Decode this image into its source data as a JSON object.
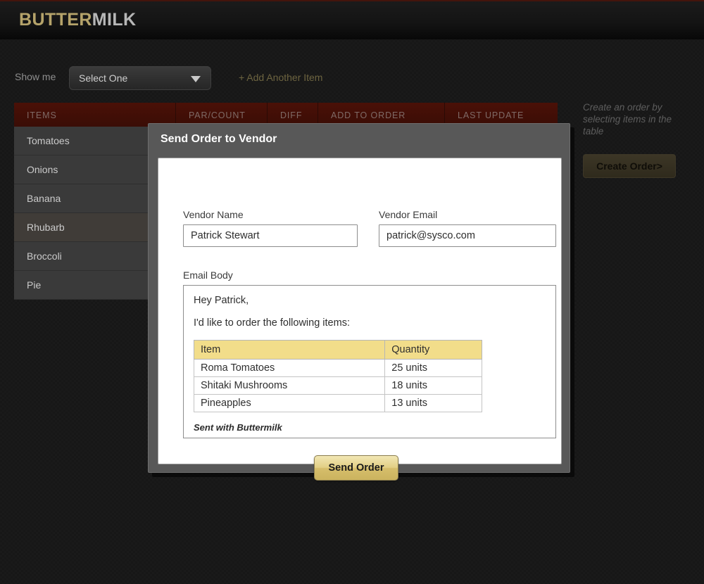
{
  "app": {
    "logo_primary": "BUTTER",
    "logo_secondary": "MILK"
  },
  "colors": {
    "accent_gold": "#b5a36a",
    "header_bar": "#141414",
    "table_header_red": "#4a1007",
    "email_table_header_yellow": "#f2dd8a",
    "send_button_gold": "#e2cf85",
    "page_background": "#171717"
  },
  "filter_bar": {
    "show_me_label": "Show me",
    "select_value": "Select One",
    "add_item_link": "+ Add Another Item"
  },
  "table": {
    "columns": [
      "ITEMS",
      "PAR/COUNT",
      "DIFF",
      "ADD TO ORDER",
      "LAST UPDATE"
    ],
    "rows": [
      {
        "item": "Tomatoes",
        "par_count": "",
        "diff": "",
        "add_to_order": "",
        "last_update": ""
      },
      {
        "item": "Onions",
        "par_count": "",
        "diff": "",
        "add_to_order": "",
        "last_update": ""
      },
      {
        "item": "Banana",
        "par_count": "",
        "diff": "",
        "add_to_order": "",
        "last_update": ""
      },
      {
        "item": "Rhubarb",
        "par_count": "",
        "diff": "",
        "add_to_order": "",
        "last_update": ""
      },
      {
        "item": "Broccoli",
        "par_count": "",
        "diff": "",
        "add_to_order": "",
        "last_update": ""
      },
      {
        "item": "Pie",
        "par_count": "",
        "diff": "",
        "add_to_order": "",
        "last_update": ""
      }
    ]
  },
  "sidebar": {
    "hint": "Create an order by selecting items in the table",
    "create_order_label": "Create Order>"
  },
  "modal": {
    "title": "Send Order to Vendor",
    "vendor_name_label": "Vendor Name",
    "vendor_name_value": "Patrick Stewart",
    "vendor_name_placeholder": "Vendor Name",
    "vendor_email_label": "Vendor Email",
    "vendor_email_value": "patrick@sysco.com",
    "vendor_email_placeholder": "Vendor Email",
    "email_body_label": "Email Body",
    "email_body": {
      "greeting": "Hey Patrick,",
      "intro": "I'd like to order the following items:",
      "table_columns": [
        "Item",
        "Quantity"
      ],
      "table_rows": [
        {
          "item": "Roma Tomatoes",
          "quantity": "25 units"
        },
        {
          "item": "Shitaki Mushrooms",
          "quantity": "18 units"
        },
        {
          "item": "Pineapples",
          "quantity": "13 units"
        }
      ],
      "footer": "Sent with Buttermilk"
    },
    "send_order_label": "Send Order"
  }
}
